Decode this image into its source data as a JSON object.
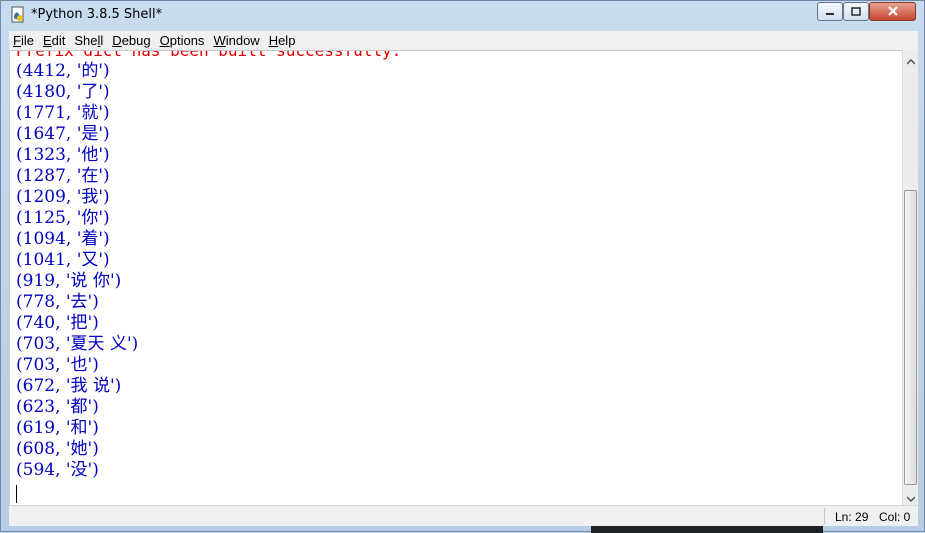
{
  "window": {
    "title": "*Python 3.8.5 Shell*"
  },
  "menu": [
    {
      "pre": "",
      "key": "F",
      "post": "ile"
    },
    {
      "pre": "",
      "key": "E",
      "post": "dit"
    },
    {
      "pre": "She",
      "key": "l",
      "post": "l"
    },
    {
      "pre": "",
      "key": "D",
      "post": "ebug"
    },
    {
      "pre": "",
      "key": "O",
      "post": "ptions"
    },
    {
      "pre": "",
      "key": "W",
      "post": "indow"
    },
    {
      "pre": "",
      "key": "H",
      "post": "elp"
    }
  ],
  "shell": {
    "stderr_line": "Prefix dict has been built successfully.",
    "output_lines": [
      "(4412, '的')",
      "(4180, '了')",
      "(1771, '就')",
      "(1647, '是')",
      "(1323, '他')",
      "(1287, '在')",
      "(1209, '我')",
      "(1125, '你')",
      "(1094, '着')",
      "(1041, '又')",
      "(919, '说 你')",
      "(778, '去')",
      "(740, '把')",
      "(703, '夏天 义')",
      "(703, '也')",
      "(672, '我 说')",
      "(623, '都')",
      "(619, '和')",
      "(608, '她')",
      "(594, '没')"
    ],
    "colors": {
      "stdout": "#0000c0",
      "stderr": "#dd0000"
    }
  },
  "status": {
    "ln": "Ln: 29",
    "col": "Col: 0"
  },
  "icons": {
    "app": "python-idle-icon",
    "minimize": "minimize-icon",
    "maximize": "maximize-icon",
    "close": "close-icon",
    "scroll_up": "chevron-up-icon",
    "scroll_down": "chevron-down-icon"
  }
}
